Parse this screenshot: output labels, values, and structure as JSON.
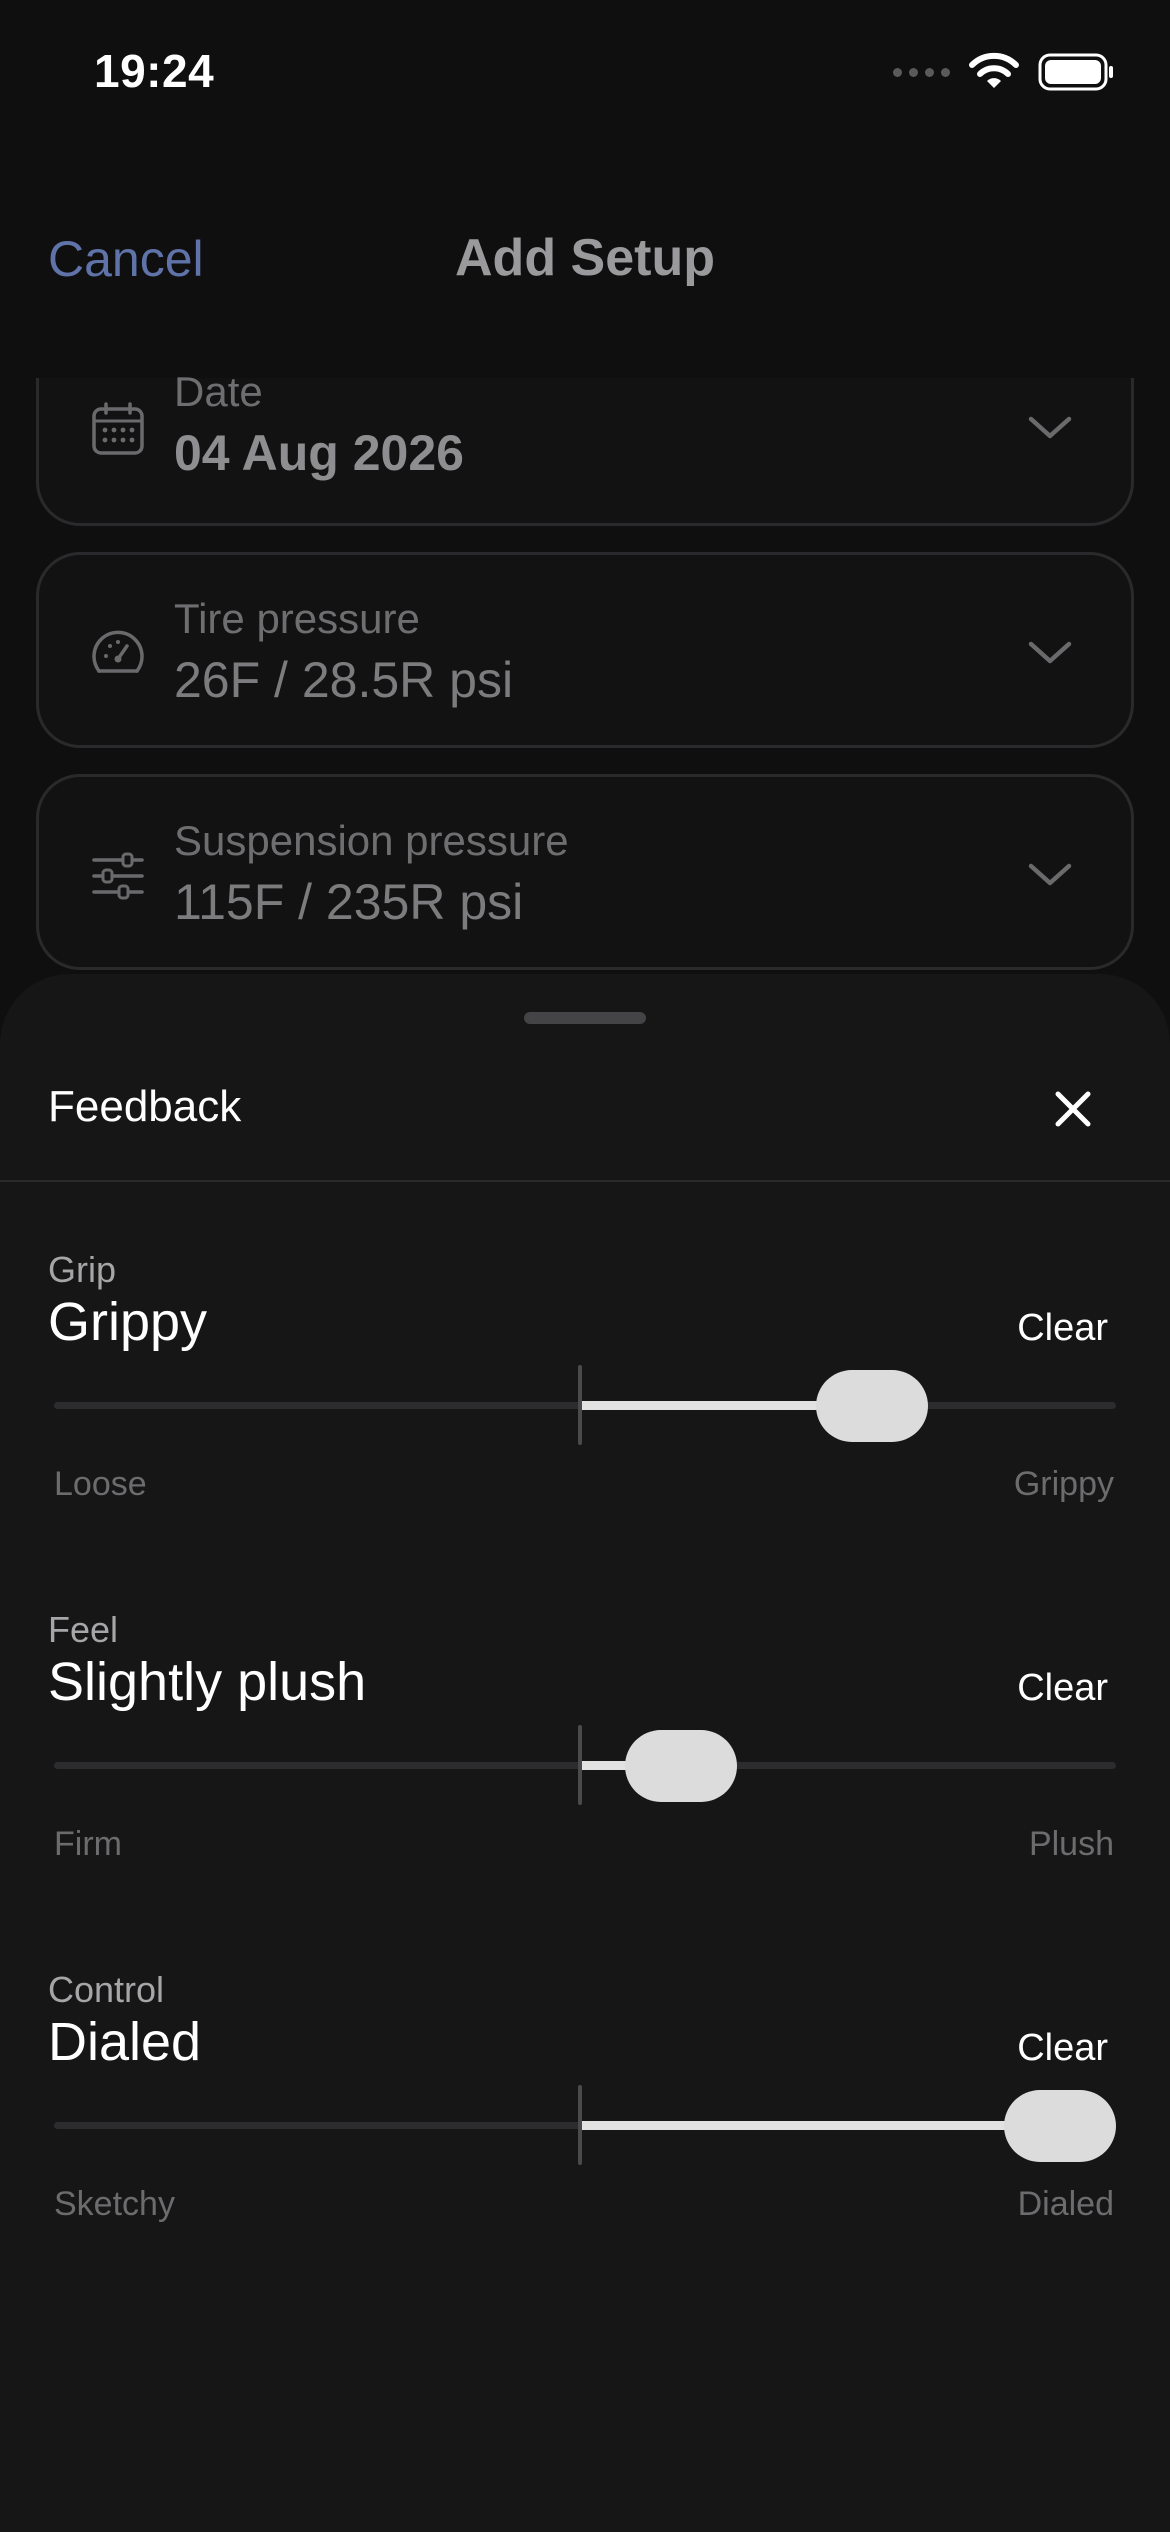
{
  "status_bar": {
    "time": "19:24",
    "icons": [
      "signal-dots-icon",
      "wifi-icon",
      "battery-icon"
    ]
  },
  "nav": {
    "cancel_label": "Cancel",
    "title": "Add Setup"
  },
  "cards": [
    {
      "icon": "calendar-icon",
      "label": "Date",
      "value": "04 Aug 2026"
    },
    {
      "icon": "gauge-icon",
      "label": "Tire pressure",
      "value": "26F / 28.5R psi"
    },
    {
      "icon": "sliders-icon",
      "label": "Suspension pressure",
      "value": "115F / 235R psi"
    }
  ],
  "sheet": {
    "title": "Feedback",
    "close_icon": "close-icon",
    "sections": [
      {
        "category": "Grip",
        "value": "Grippy",
        "clear_label": "Clear",
        "min_label": "Loose",
        "max_label": "Grippy",
        "level": 0.77
      },
      {
        "category": "Feel",
        "value": "Slightly plush",
        "clear_label": "Clear",
        "min_label": "Firm",
        "max_label": "Plush",
        "level": 0.59
      },
      {
        "category": "Control",
        "value": "Dialed",
        "clear_label": "Clear",
        "min_label": "Sketchy",
        "max_label": "Dialed",
        "level": 0.96
      }
    ]
  },
  "colors": {
    "background": "#0f0f10",
    "sheet": "#161617",
    "accent_cancel": "#5f73a8",
    "thumb": "#dcdcdc"
  }
}
